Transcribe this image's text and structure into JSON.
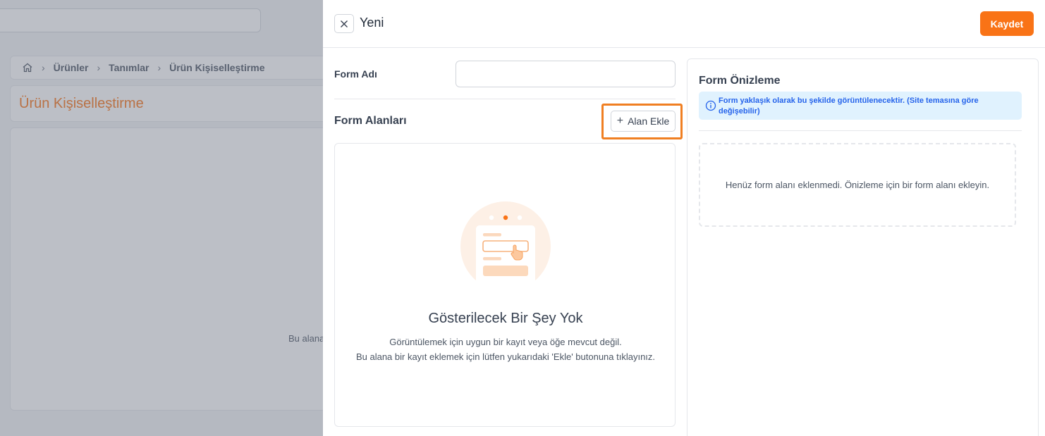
{
  "background": {
    "breadcrumb": [
      "Ürünler",
      "Tanımlar",
      "Ürün Kişiselleştirme"
    ],
    "page_title": "Ürün Kişiselleştirme",
    "content_text": "Bu alana"
  },
  "drawer": {
    "title": "Yeni",
    "save_label": "Kaydet",
    "form_name_label": "Form Adı",
    "form_name_value": "",
    "fields_heading": "Form Alanları",
    "add_field_label": "Alan Ekle",
    "empty_title": "Gösterilecek Bir Şey Yok",
    "empty_line1": "Görüntülemek için uygun bir kayıt veya öğe mevcut değil.",
    "empty_line2": "Bu alana bir kayıt eklemek için lütfen yukarıdaki 'Ekle' butonuna tıklayınız."
  },
  "preview": {
    "title": "Form Önizleme",
    "info_text": "Form yaklaşık olarak bu şekilde görüntülenecektir. (Site temasına göre değişebilir)",
    "empty_text": "Henüz form alanı eklenmedi. Önizleme için bir form alanı ekleyin."
  },
  "colors": {
    "accent": "#f97316",
    "highlight": "#f07f22",
    "info_bg": "#e0f2fe",
    "info_text": "#2563eb"
  },
  "icons": [
    "home-icon",
    "chevron-right-icon",
    "close-icon",
    "plus-icon",
    "info-icon",
    "empty-form-illustration"
  ]
}
